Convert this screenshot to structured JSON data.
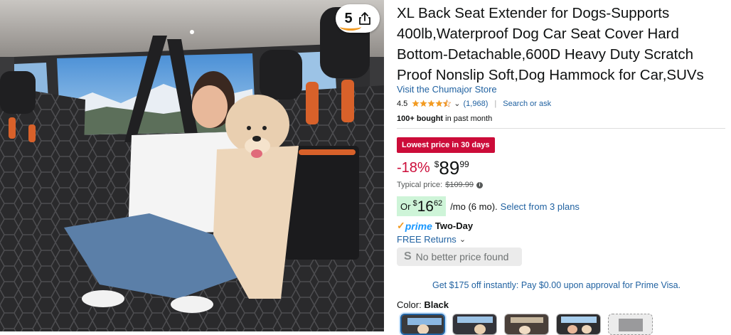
{
  "product": {
    "title": "XL Back Seat Extender for Dogs-Supports 400lb,Waterproof Dog Car Seat Cover Hard Bottom-Detachable,600D Heavy Duty Scratch Proof Nonslip Soft,Dog Hammock for Car,SUVs",
    "store_link": "Visit the Chumajor Store",
    "rating": "4.5",
    "rating_fraction": 0.9,
    "rating_count": "(1,968)",
    "search_ask": "Search or ask",
    "bought_bold": "100+ bought",
    "bought_rest": " in past month"
  },
  "share": {
    "count": "5",
    "icon": "share-icon"
  },
  "pricing": {
    "deal_badge": "Lowest price in 30 days",
    "discount": "-18%",
    "currency": "$",
    "whole": "89",
    "fraction": "99",
    "typical_label": "Typical price:",
    "typical_value": "$109.99",
    "info_icon": "i"
  },
  "monthly": {
    "or": "Or",
    "currency": "$",
    "whole": "16",
    "fraction": "62",
    "term": "/mo (6 mo).",
    "plans_link": "Select from 3 plans"
  },
  "delivery": {
    "prime_check": "✓",
    "prime_word": "prime",
    "two_day": "Two-Day",
    "returns": "FREE Returns"
  },
  "no_better_price": {
    "icon": "S",
    "text": "No better price found"
  },
  "offer": "Get $175 off instantly: Pay $0.00 upon approval for Prime Visa.",
  "color": {
    "label": "Color:",
    "value": "Black"
  },
  "colors": {
    "accent": "#2162a1",
    "deal": "#cc0c39",
    "prime": "#1a98ff",
    "star": "#f29b22"
  }
}
